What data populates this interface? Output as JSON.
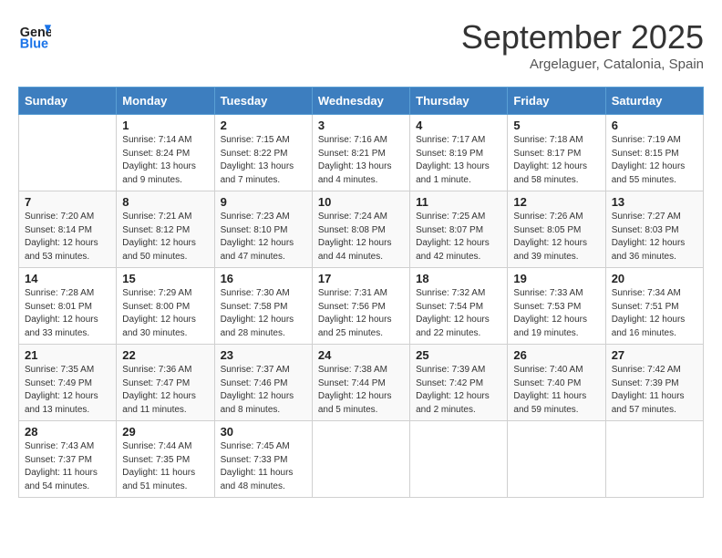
{
  "header": {
    "logo_line1": "General",
    "logo_line2": "Blue",
    "month_title": "September 2025",
    "location": "Argelaguer, Catalonia, Spain"
  },
  "weekdays": [
    "Sunday",
    "Monday",
    "Tuesday",
    "Wednesday",
    "Thursday",
    "Friday",
    "Saturday"
  ],
  "weeks": [
    [
      {
        "day": "",
        "sunrise": "",
        "sunset": "",
        "daylight": ""
      },
      {
        "day": "1",
        "sunrise": "Sunrise: 7:14 AM",
        "sunset": "Sunset: 8:24 PM",
        "daylight": "Daylight: 13 hours and 9 minutes."
      },
      {
        "day": "2",
        "sunrise": "Sunrise: 7:15 AM",
        "sunset": "Sunset: 8:22 PM",
        "daylight": "Daylight: 13 hours and 7 minutes."
      },
      {
        "day": "3",
        "sunrise": "Sunrise: 7:16 AM",
        "sunset": "Sunset: 8:21 PM",
        "daylight": "Daylight: 13 hours and 4 minutes."
      },
      {
        "day": "4",
        "sunrise": "Sunrise: 7:17 AM",
        "sunset": "Sunset: 8:19 PM",
        "daylight": "Daylight: 13 hours and 1 minute."
      },
      {
        "day": "5",
        "sunrise": "Sunrise: 7:18 AM",
        "sunset": "Sunset: 8:17 PM",
        "daylight": "Daylight: 12 hours and 58 minutes."
      },
      {
        "day": "6",
        "sunrise": "Sunrise: 7:19 AM",
        "sunset": "Sunset: 8:15 PM",
        "daylight": "Daylight: 12 hours and 55 minutes."
      }
    ],
    [
      {
        "day": "7",
        "sunrise": "Sunrise: 7:20 AM",
        "sunset": "Sunset: 8:14 PM",
        "daylight": "Daylight: 12 hours and 53 minutes."
      },
      {
        "day": "8",
        "sunrise": "Sunrise: 7:21 AM",
        "sunset": "Sunset: 8:12 PM",
        "daylight": "Daylight: 12 hours and 50 minutes."
      },
      {
        "day": "9",
        "sunrise": "Sunrise: 7:23 AM",
        "sunset": "Sunset: 8:10 PM",
        "daylight": "Daylight: 12 hours and 47 minutes."
      },
      {
        "day": "10",
        "sunrise": "Sunrise: 7:24 AM",
        "sunset": "Sunset: 8:08 PM",
        "daylight": "Daylight: 12 hours and 44 minutes."
      },
      {
        "day": "11",
        "sunrise": "Sunrise: 7:25 AM",
        "sunset": "Sunset: 8:07 PM",
        "daylight": "Daylight: 12 hours and 42 minutes."
      },
      {
        "day": "12",
        "sunrise": "Sunrise: 7:26 AM",
        "sunset": "Sunset: 8:05 PM",
        "daylight": "Daylight: 12 hours and 39 minutes."
      },
      {
        "day": "13",
        "sunrise": "Sunrise: 7:27 AM",
        "sunset": "Sunset: 8:03 PM",
        "daylight": "Daylight: 12 hours and 36 minutes."
      }
    ],
    [
      {
        "day": "14",
        "sunrise": "Sunrise: 7:28 AM",
        "sunset": "Sunset: 8:01 PM",
        "daylight": "Daylight: 12 hours and 33 minutes."
      },
      {
        "day": "15",
        "sunrise": "Sunrise: 7:29 AM",
        "sunset": "Sunset: 8:00 PM",
        "daylight": "Daylight: 12 hours and 30 minutes."
      },
      {
        "day": "16",
        "sunrise": "Sunrise: 7:30 AM",
        "sunset": "Sunset: 7:58 PM",
        "daylight": "Daylight: 12 hours and 28 minutes."
      },
      {
        "day": "17",
        "sunrise": "Sunrise: 7:31 AM",
        "sunset": "Sunset: 7:56 PM",
        "daylight": "Daylight: 12 hours and 25 minutes."
      },
      {
        "day": "18",
        "sunrise": "Sunrise: 7:32 AM",
        "sunset": "Sunset: 7:54 PM",
        "daylight": "Daylight: 12 hours and 22 minutes."
      },
      {
        "day": "19",
        "sunrise": "Sunrise: 7:33 AM",
        "sunset": "Sunset: 7:53 PM",
        "daylight": "Daylight: 12 hours and 19 minutes."
      },
      {
        "day": "20",
        "sunrise": "Sunrise: 7:34 AM",
        "sunset": "Sunset: 7:51 PM",
        "daylight": "Daylight: 12 hours and 16 minutes."
      }
    ],
    [
      {
        "day": "21",
        "sunrise": "Sunrise: 7:35 AM",
        "sunset": "Sunset: 7:49 PM",
        "daylight": "Daylight: 12 hours and 13 minutes."
      },
      {
        "day": "22",
        "sunrise": "Sunrise: 7:36 AM",
        "sunset": "Sunset: 7:47 PM",
        "daylight": "Daylight: 12 hours and 11 minutes."
      },
      {
        "day": "23",
        "sunrise": "Sunrise: 7:37 AM",
        "sunset": "Sunset: 7:46 PM",
        "daylight": "Daylight: 12 hours and 8 minutes."
      },
      {
        "day": "24",
        "sunrise": "Sunrise: 7:38 AM",
        "sunset": "Sunset: 7:44 PM",
        "daylight": "Daylight: 12 hours and 5 minutes."
      },
      {
        "day": "25",
        "sunrise": "Sunrise: 7:39 AM",
        "sunset": "Sunset: 7:42 PM",
        "daylight": "Daylight: 12 hours and 2 minutes."
      },
      {
        "day": "26",
        "sunrise": "Sunrise: 7:40 AM",
        "sunset": "Sunset: 7:40 PM",
        "daylight": "Daylight: 11 hours and 59 minutes."
      },
      {
        "day": "27",
        "sunrise": "Sunrise: 7:42 AM",
        "sunset": "Sunset: 7:39 PM",
        "daylight": "Daylight: 11 hours and 57 minutes."
      }
    ],
    [
      {
        "day": "28",
        "sunrise": "Sunrise: 7:43 AM",
        "sunset": "Sunset: 7:37 PM",
        "daylight": "Daylight: 11 hours and 54 minutes."
      },
      {
        "day": "29",
        "sunrise": "Sunrise: 7:44 AM",
        "sunset": "Sunset: 7:35 PM",
        "daylight": "Daylight: 11 hours and 51 minutes."
      },
      {
        "day": "30",
        "sunrise": "Sunrise: 7:45 AM",
        "sunset": "Sunset: 7:33 PM",
        "daylight": "Daylight: 11 hours and 48 minutes."
      },
      {
        "day": "",
        "sunrise": "",
        "sunset": "",
        "daylight": ""
      },
      {
        "day": "",
        "sunrise": "",
        "sunset": "",
        "daylight": ""
      },
      {
        "day": "",
        "sunrise": "",
        "sunset": "",
        "daylight": ""
      },
      {
        "day": "",
        "sunrise": "",
        "sunset": "",
        "daylight": ""
      }
    ]
  ]
}
